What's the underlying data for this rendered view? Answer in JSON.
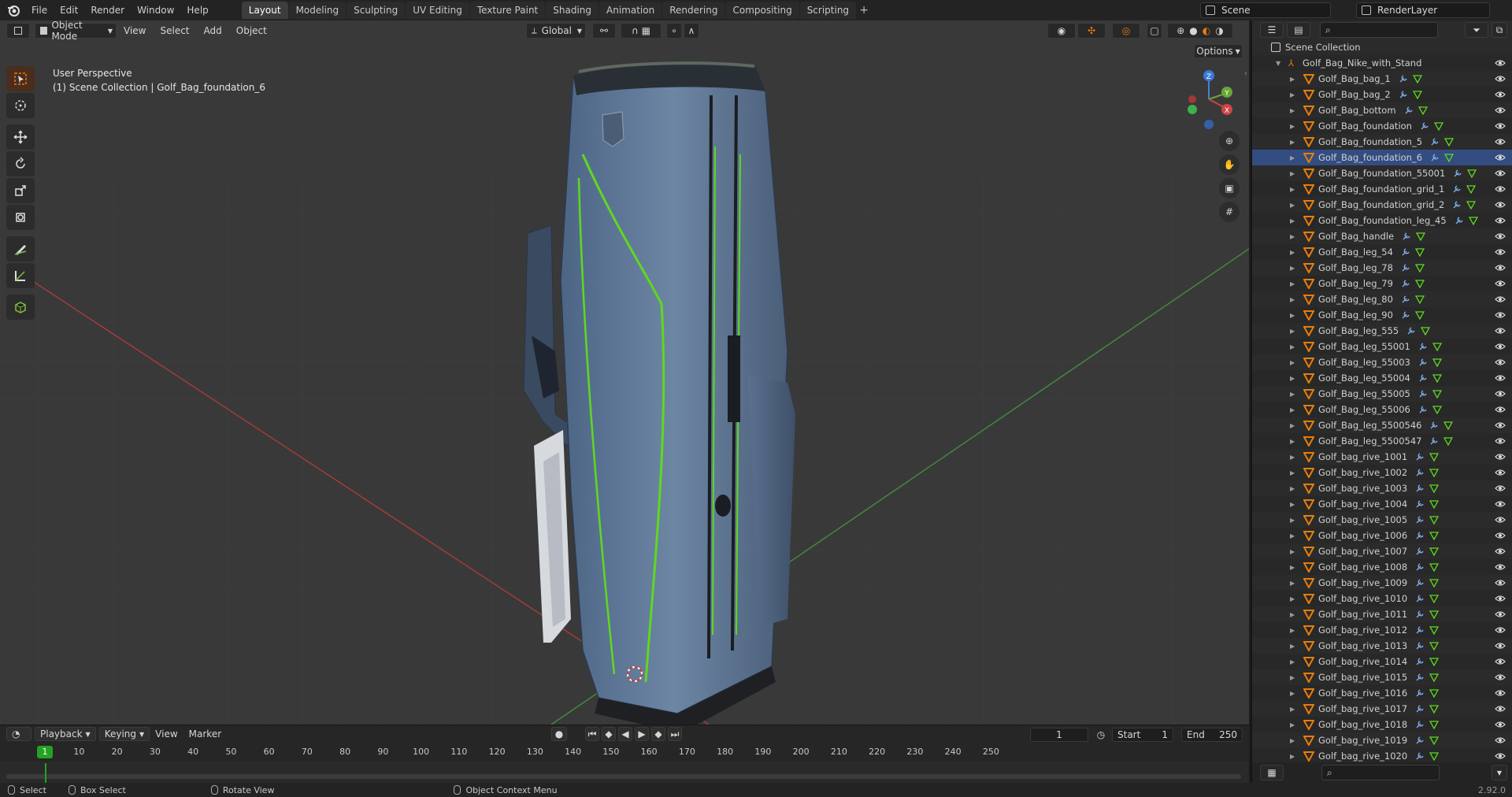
{
  "top_menu": {
    "items": [
      "File",
      "Edit",
      "Render",
      "Window",
      "Help"
    ],
    "workspaces": [
      "Layout",
      "Modeling",
      "Sculpting",
      "UV Editing",
      "Texture Paint",
      "Shading",
      "Animation",
      "Rendering",
      "Compositing",
      "Scripting"
    ],
    "active_workspace": "Layout",
    "add_tab": "+",
    "scene": "Scene",
    "view_layer": "RenderLayer"
  },
  "viewport": {
    "mode": "Object Mode",
    "menus": [
      "View",
      "Select",
      "Add",
      "Object"
    ],
    "transform_orientation": "Global",
    "options": "Options",
    "perspective_label": "User Perspective",
    "context_label": "(1) Scene Collection | Golf_Bag_foundation_6",
    "gizmo": {
      "x": "X",
      "y": "Y",
      "z": "Z"
    }
  },
  "timeline": {
    "menus": [
      "Playback",
      "Keying",
      "View",
      "Marker"
    ],
    "current_frame": "1",
    "start_label": "Start",
    "start": "1",
    "end_label": "End",
    "end": "250",
    "ticks": [
      "10",
      "20",
      "30",
      "40",
      "50",
      "60",
      "70",
      "80",
      "90",
      "100",
      "110",
      "120",
      "130",
      "140",
      "150",
      "160",
      "170",
      "180",
      "190",
      "200",
      "210",
      "220",
      "230",
      "240",
      "250"
    ],
    "cursor_label": "1"
  },
  "status_bar": {
    "select": "Select",
    "box_select": "Box Select",
    "rotate_view": "Rotate View",
    "context_menu": "Object Context Menu",
    "version": "2.92.0"
  },
  "outliner": {
    "root": "Scene Collection",
    "parent": "Golf_Bag_Nike_with_Stand",
    "selected_index": 5,
    "items": [
      "Golf_Bag_bag_1",
      "Golf_Bag_bag_2",
      "Golf_Bag_bottom",
      "Golf_Bag_foundation",
      "Golf_Bag_foundation_5",
      "Golf_Bag_foundation_6",
      "Golf_Bag_foundation_55001",
      "Golf_Bag_foundation_grid_1",
      "Golf_Bag_foundation_grid_2",
      "Golf_Bag_foundation_leg_45",
      "Golf_Bag_handle",
      "Golf_Bag_leg_54",
      "Golf_Bag_leg_78",
      "Golf_Bag_leg_79",
      "Golf_Bag_leg_80",
      "Golf_Bag_leg_90",
      "Golf_Bag_leg_555",
      "Golf_Bag_leg_55001",
      "Golf_Bag_leg_55003",
      "Golf_Bag_leg_55004",
      "Golf_Bag_leg_55005",
      "Golf_Bag_leg_55006",
      "Golf_Bag_leg_5500546",
      "Golf_Bag_leg_5500547",
      "Golf_bag_rive_1001",
      "Golf_bag_rive_1002",
      "Golf_bag_rive_1003",
      "Golf_bag_rive_1004",
      "Golf_bag_rive_1005",
      "Golf_bag_rive_1006",
      "Golf_bag_rive_1007",
      "Golf_bag_rive_1008",
      "Golf_bag_rive_1009",
      "Golf_bag_rive_1010",
      "Golf_bag_rive_1011",
      "Golf_bag_rive_1012",
      "Golf_bag_rive_1013",
      "Golf_bag_rive_1014",
      "Golf_bag_rive_1015",
      "Golf_bag_rive_1016",
      "Golf_bag_rive_1017",
      "Golf_bag_rive_1018",
      "Golf_bag_rive_1019",
      "Golf_bag_rive_1020"
    ]
  },
  "colors": {
    "accent_orange": "#e87d0d",
    "selection_blue": "#334d80",
    "frame_green": "#23a323",
    "axis_red": "#c44",
    "axis_green": "#4a4"
  }
}
